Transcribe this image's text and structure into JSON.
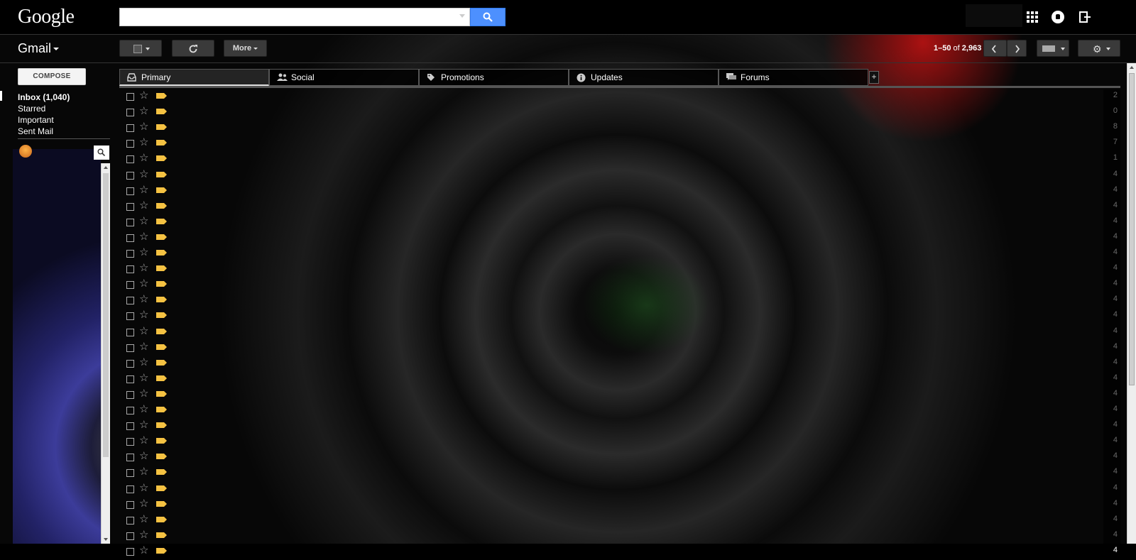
{
  "app": {
    "brand": "Google",
    "product": "Gmail"
  },
  "search": {
    "value": "",
    "placeholder": ""
  },
  "toolbar": {
    "more_label": "More",
    "page_range": "1–50",
    "page_of": "of",
    "page_total": "2,963"
  },
  "nav": {
    "compose_label": "COMPOSE",
    "items": [
      {
        "label": "Inbox (1,040)",
        "active": true
      },
      {
        "label": "Starred"
      },
      {
        "label": "Important"
      },
      {
        "label": "Sent Mail"
      }
    ]
  },
  "tabs": [
    {
      "label": "Primary",
      "icon": "inbox-icon",
      "active": true
    },
    {
      "label": "Social",
      "icon": "people-icon"
    },
    {
      "label": "Promotions",
      "icon": "tag-icon"
    },
    {
      "label": "Updates",
      "icon": "info-icon"
    },
    {
      "label": "Forums",
      "icon": "forum-icon"
    }
  ],
  "rows": [
    "2",
    "0",
    "8",
    "7",
    "1",
    "4",
    "4",
    "4",
    "4",
    "4",
    "4",
    "4",
    "4",
    "4",
    "4",
    "4",
    "4",
    "4",
    "4",
    "4",
    "4",
    "4",
    "4",
    "4",
    "4",
    "4",
    "4",
    "4",
    "4",
    "4"
  ],
  "colors": {
    "search_button": "#4d90fe",
    "label_tag": "#f5c242",
    "background": "#000000"
  }
}
